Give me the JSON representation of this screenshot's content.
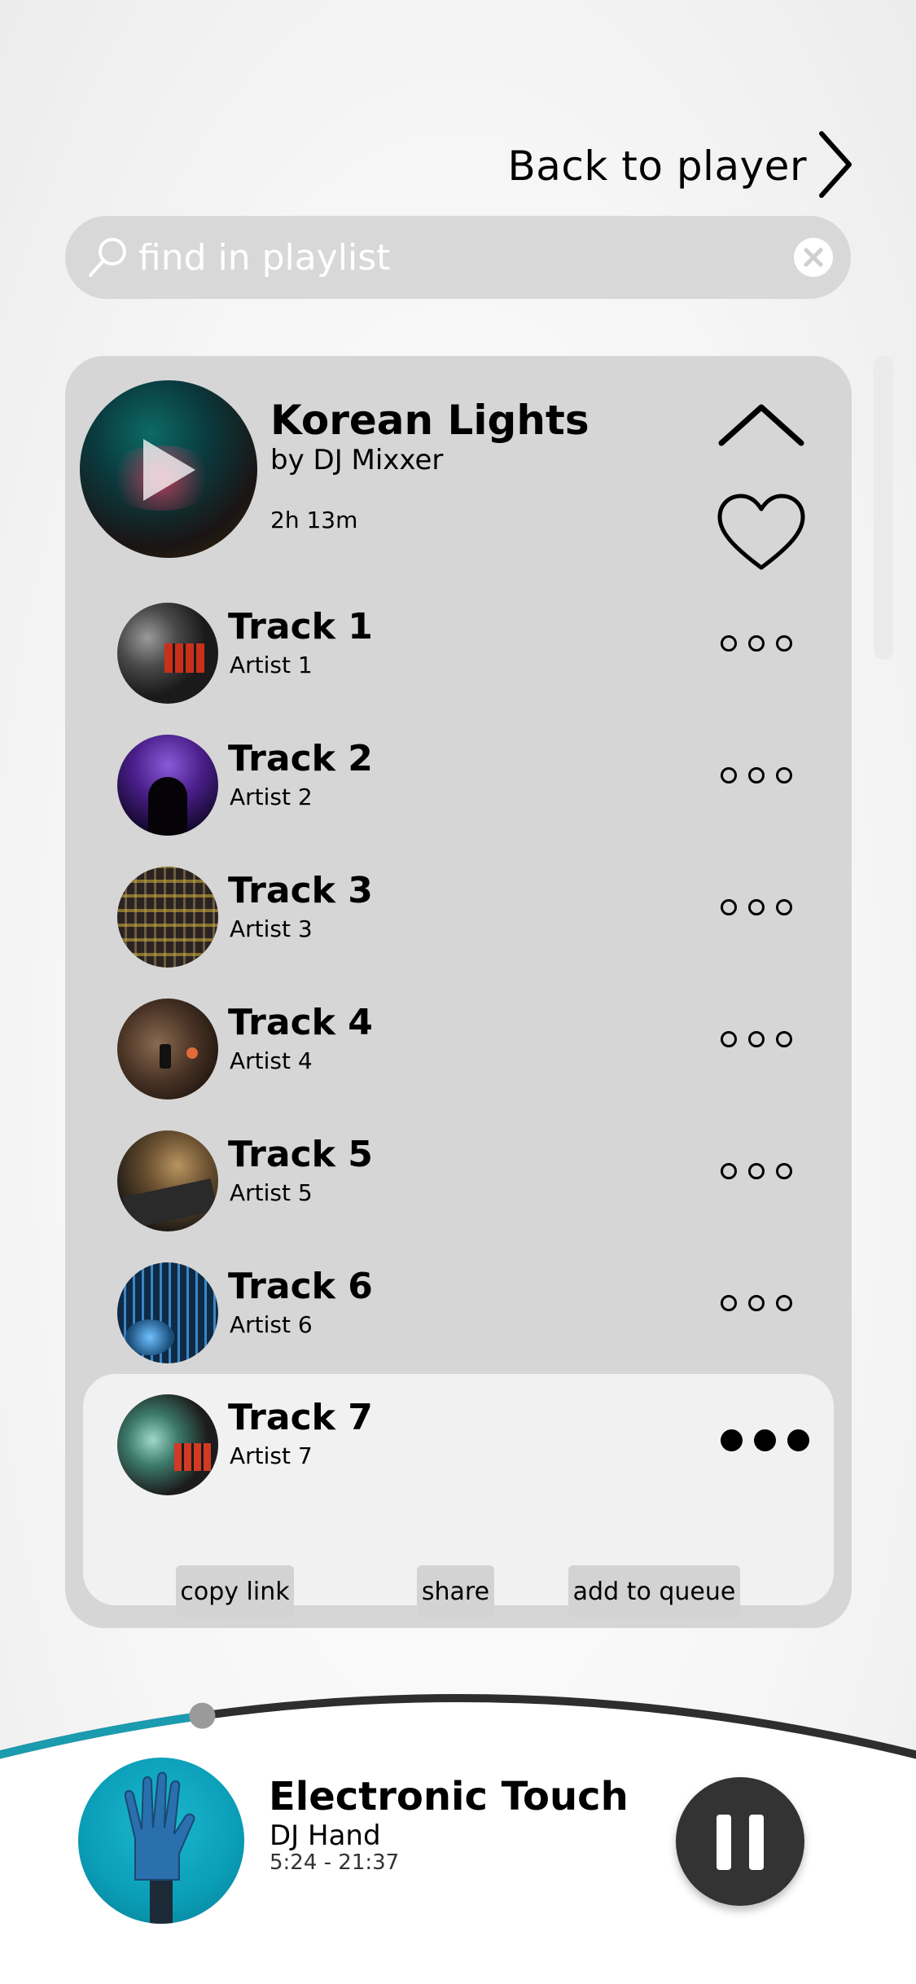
{
  "nav": {
    "back_label": "Back to player"
  },
  "search": {
    "placeholder": "find in playlist",
    "value": ""
  },
  "playlist": {
    "title": "Korean Lights",
    "artist": "by DJ Mixxer",
    "duration": "2h 13m"
  },
  "tracks": [
    {
      "title": "Track 1",
      "artist": "Artist 1"
    },
    {
      "title": "Track 2",
      "artist": "Artist 2"
    },
    {
      "title": "Track 3",
      "artist": "Artist 3"
    },
    {
      "title": "Track 4",
      "artist": "Artist 4"
    },
    {
      "title": "Track 5",
      "artist": "Artist 5"
    },
    {
      "title": "Track 6",
      "artist": "Artist 6"
    },
    {
      "title": "Track 7",
      "artist": "Artist 7"
    }
  ],
  "track_actions": {
    "copy_link": "copy link",
    "share": "share",
    "add_to_queue": "add to queue"
  },
  "now_playing": {
    "title": "Electronic Touch",
    "artist": "DJ Hand",
    "time": "5:24 - 21:37",
    "progress": 0.25
  },
  "colors": {
    "accent": "#1a9bb0",
    "panel": "#d6d6d6",
    "active_row": "#f1f1f1",
    "dark": "#333333"
  },
  "icons": {
    "search": "search-icon",
    "clear": "clear-icon",
    "back": "chevron-right-icon",
    "collapse": "chevron-up-icon",
    "favorite": "heart-icon",
    "more": "more-icon",
    "pause": "pause-icon"
  }
}
